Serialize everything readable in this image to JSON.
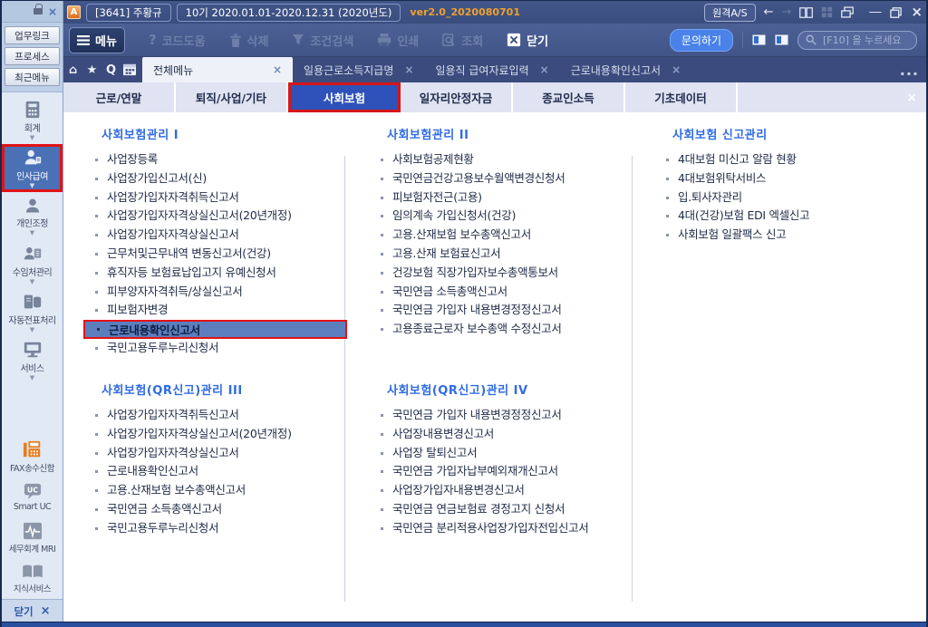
{
  "icons": {
    "close_x": "×",
    "home": "⌂",
    "star": "★",
    "q_search": "Q",
    "overflow": "...",
    "back_arrow": "←",
    "forward_arrow": "→",
    "minimize": "―",
    "question": "?",
    "caret": "▼",
    "uc": "UC",
    "logo_a": "A"
  },
  "titlebar": {
    "client": "[3641] 주황규",
    "period": "10기  2020.01.01-2020.12.31  (2020년도)",
    "version": "ver2.0_2020080701",
    "remote": "원격A/S"
  },
  "toolbar": {
    "menu": "메뉴",
    "code_help": "코드도움",
    "delete": "삭제",
    "cond_search": "조건검색",
    "print": "인쇄",
    "view": "조회",
    "close": "닫기",
    "inquiry": "문의하기",
    "search_placeholder": "[F10] 을 누르세요"
  },
  "tabstrip": {
    "tabs": [
      {
        "label": "전체메뉴",
        "active": true
      },
      {
        "label": "일용근로소득지급명"
      },
      {
        "label": "일용직 급여자료입력"
      },
      {
        "label": "근로내용확인신고서"
      }
    ]
  },
  "sidebar": {
    "top_buttons": [
      {
        "label": "업무링크"
      },
      {
        "label": "프로세스"
      },
      {
        "label": "최근메뉴"
      }
    ],
    "nav": [
      {
        "label": "회계"
      },
      {
        "label": "인사급여",
        "selected": true
      },
      {
        "label": "개인조정"
      },
      {
        "label": "수임처관리"
      },
      {
        "label": "자동전표처리"
      },
      {
        "label": "서비스"
      }
    ],
    "lower": [
      {
        "label": "FAX송수신함"
      },
      {
        "label": "Smart UC"
      },
      {
        "label": "세무회계 MRI"
      },
      {
        "label": "지식서비스"
      }
    ],
    "close": "닫기"
  },
  "category_tabs": [
    {
      "label": "근로/연말"
    },
    {
      "label": "퇴직/사업/기타"
    },
    {
      "label": "사회보험",
      "selected": true
    },
    {
      "label": "일자리안정자금"
    },
    {
      "label": "종교인소득"
    },
    {
      "label": "기초데이터"
    }
  ],
  "menu_sections": [
    {
      "title": "사회보험관리  I",
      "items": [
        {
          "label": "사업장등록"
        },
        {
          "label": "사업장가입신고서(신)"
        },
        {
          "label": "사업장가입자자격취득신고서"
        },
        {
          "label": "사업장가입자자격상실신고서(20년개정)"
        },
        {
          "label": "사업장가입자자격상실신고서"
        },
        {
          "label": "근무처및근무내역 변동신고서(건강)"
        },
        {
          "label": "휴직자등 보험료납입고지 유예신청서"
        },
        {
          "label": "피부양자자격취득/상실신고서"
        },
        {
          "label": "피보험자변경"
        },
        {
          "label": "근로내용확인신고서",
          "highlight": true
        },
        {
          "label": "국민고용두루누리신청서"
        }
      ]
    },
    {
      "title": "사회보험관리  II",
      "items": [
        {
          "label": "사회보험공제현황"
        },
        {
          "label": "국민연금건강고용보수월액변경신청서"
        },
        {
          "label": "피보험자전근(고용)"
        },
        {
          "label": "임의계속 가입신청서(건강)"
        },
        {
          "label": "고용.산재보험 보수총액신고서"
        },
        {
          "label": "고용.산재 보험료신고서"
        },
        {
          "label": "건강보험 직장가입자보수총액통보서"
        },
        {
          "label": "국민연금 소득총액신고서"
        },
        {
          "label": "국민연금 가입자 내용변경정정신고서"
        },
        {
          "label": "고용종료근로자 보수총액 수정신고서"
        }
      ]
    },
    {
      "title": "사회보험 신고관리",
      "items": [
        {
          "label": "4대보험 미신고 알람 현황"
        },
        {
          "label": "4대보험위탁서비스"
        },
        {
          "label": "입.퇴사자관리"
        },
        {
          "label": "4대(건강)보험 EDI 엑셀신고"
        },
        {
          "label": "사회보험 일괄팩스 신고"
        }
      ]
    },
    {
      "title": "사회보험(QR신고)관리  III",
      "items": [
        {
          "label": "사업장가입자자격취득신고서"
        },
        {
          "label": "사업장가입자자격상실신고서(20년개정)"
        },
        {
          "label": "사업장가입자자격상실신고서"
        },
        {
          "label": "근로내용확인신고서"
        },
        {
          "label": "고용.산재보험 보수총액신고서"
        },
        {
          "label": "국민연금 소득총액신고서"
        },
        {
          "label": "국민고용두루누리신청서"
        }
      ]
    },
    {
      "title": "사회보험(QR신고)관리  IV",
      "items": [
        {
          "label": "국민연금 가입자 내용변경정정신고서"
        },
        {
          "label": "사업장내용변경신고서"
        },
        {
          "label": "사업장 탈퇴신고서"
        },
        {
          "label": "국민연금 가입자납부예외재개신고서"
        },
        {
          "label": "사업장가입자내용변경신고서"
        },
        {
          "label": "국민연금 연금보험료 경정고지 신청서"
        },
        {
          "label": "국민연금 분리적용사업장가입자전입신고서"
        }
      ]
    }
  ]
}
